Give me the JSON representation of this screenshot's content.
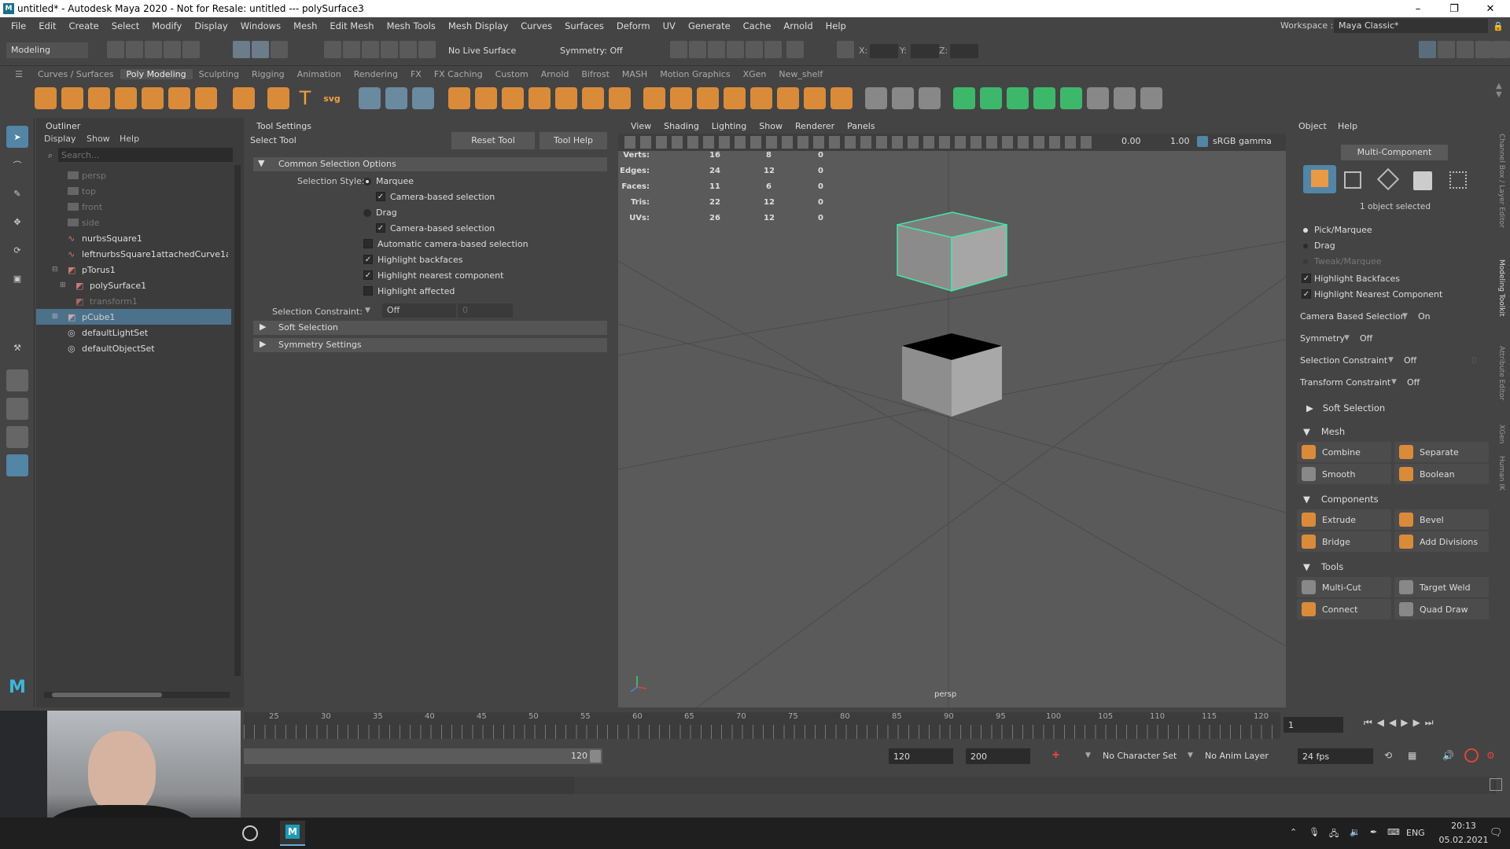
{
  "window": {
    "title": "untitled* - Autodesk Maya 2020 - Not for Resale: untitled   ---   polySurface3",
    "minimize": "–",
    "maximize": "❐",
    "close": "✕"
  },
  "menubar": [
    "File",
    "Edit",
    "Create",
    "Select",
    "Modify",
    "Display",
    "Windows",
    "Mesh",
    "Edit Mesh",
    "Mesh Tools",
    "Mesh Display",
    "Curves",
    "Surfaces",
    "Deform",
    "UV",
    "Generate",
    "Cache",
    "Arnold",
    "Help"
  ],
  "workspace": {
    "label": "Workspace :",
    "value": "Maya Classic*"
  },
  "statusline": {
    "mode": "Modeling",
    "live_surface": "No Live Surface",
    "symmetry": "Symmetry: Off",
    "x": "X:",
    "y": "Y:",
    "z": "Z:"
  },
  "shelf_tabs": [
    "Curves / Surfaces",
    "Poly Modeling",
    "Sculpting",
    "Rigging",
    "Animation",
    "Rendering",
    "FX",
    "FX Caching",
    "Custom",
    "Arnold",
    "Bifrost",
    "MASH",
    "Motion Graphics",
    "XGen",
    "New_shelf"
  ],
  "shelf_active": "Poly Modeling",
  "outliner": {
    "title": "Outliner",
    "menus": [
      "Display",
      "Show",
      "Help"
    ],
    "search_placeholder": "Search...",
    "items": [
      "persp",
      "top",
      "front",
      "side",
      "nurbsSquare1",
      "leftnurbsSquare1attachedCurve1attac",
      "pTorus1",
      "polySurface1",
      "transform1",
      "pCube1",
      "defaultLightSet",
      "defaultObjectSet"
    ]
  },
  "tool_settings": {
    "title": "Tool Settings",
    "tool_name": "Select Tool",
    "reset": "Reset Tool",
    "help": "Tool Help",
    "common_header": "Common Selection Options",
    "selection_style_label": "Selection Style:",
    "marquee": "Marquee",
    "camera_based_1": "Camera-based selection",
    "drag": "Drag",
    "camera_based_2": "Camera-based selection",
    "auto_camera": "Automatic camera-based selection",
    "highlight_backfaces": "Highlight backfaces",
    "highlight_nearest": "Highlight nearest component",
    "highlight_affected": "Highlight affected",
    "constraint_label": "Selection Constraint:",
    "constraint_value": "Off",
    "constraint_num": "0",
    "soft_selection": "Soft Selection",
    "symmetry_settings": "Symmetry Settings",
    "check": "✓"
  },
  "viewport": {
    "menus": [
      "View",
      "Shading",
      "Lighting",
      "Show",
      "Renderer",
      "Panels"
    ],
    "exposure": "0.00",
    "gamma": "1.00",
    "colorspace": "sRGB gamma",
    "camera": "persp",
    "hud": [
      {
        "label": "Verts:",
        "a": "16",
        "b": "8",
        "c": "0"
      },
      {
        "label": "Edges:",
        "a": "24",
        "b": "12",
        "c": "0"
      },
      {
        "label": "Faces:",
        "a": "11",
        "b": "6",
        "c": "0"
      },
      {
        "label": "Tris:",
        "a": "22",
        "b": "12",
        "c": "0"
      },
      {
        "label": "UVs:",
        "a": "26",
        "b": "12",
        "c": "0"
      }
    ]
  },
  "modeling_toolkit": {
    "menus": [
      "Object",
      "Help"
    ],
    "mode": "Multi-Component",
    "selected": "1 object selected",
    "pick": "Pick/Marquee",
    "drag": "Drag",
    "tweak": "Tweak/Marquee",
    "hl_backfaces": "Highlight Backfaces",
    "hl_nearest": "Highlight Nearest Component",
    "cam_sel_label": "Camera Based Selection",
    "cam_sel_value": "On",
    "symmetry_label": "Symmetry",
    "symmetry_value": "Off",
    "sel_constraint_label": "Selection Constraint",
    "sel_constraint_value": "Off",
    "sel_constraint_num": "0",
    "xform_constraint_label": "Transform Constraint",
    "xform_constraint_value": "Off",
    "soft_selection": "Soft Selection",
    "mesh": "Mesh",
    "combine": "Combine",
    "separate": "Separate",
    "smooth": "Smooth",
    "boolean": "Boolean",
    "components": "Components",
    "extrude": "Extrude",
    "bevel": "Bevel",
    "bridge": "Bridge",
    "add_divisions": "Add Divisions",
    "tools": "Tools",
    "multicut": "Multi-Cut",
    "target_weld": "Target Weld",
    "connect": "Connect",
    "quad_draw": "Quad Draw",
    "side_tabs": [
      "Channel Box / Layer Editor",
      "Modeling Toolkit",
      "Attribute Editor",
      "XGen",
      "Human IK"
    ]
  },
  "timeline": {
    "ticks": [
      "25",
      "30",
      "35",
      "40",
      "45",
      "50",
      "55",
      "60",
      "65",
      "70",
      "75",
      "80",
      "85",
      "90",
      "95",
      "100",
      "105",
      "110",
      "115",
      "120"
    ],
    "current_frame": "1",
    "range_end_inner": "120",
    "range_end": "120",
    "range_max": "200",
    "character_set": "No Character Set",
    "anim_layer": "No Anim Layer",
    "fps": "24 fps"
  },
  "taskbar": {
    "lang": "ENG",
    "time": "20:13",
    "date": "05.02.2021"
  },
  "colors": {
    "accent": "#5285a6",
    "wire": "#49e3a8",
    "bg": "#444444"
  }
}
